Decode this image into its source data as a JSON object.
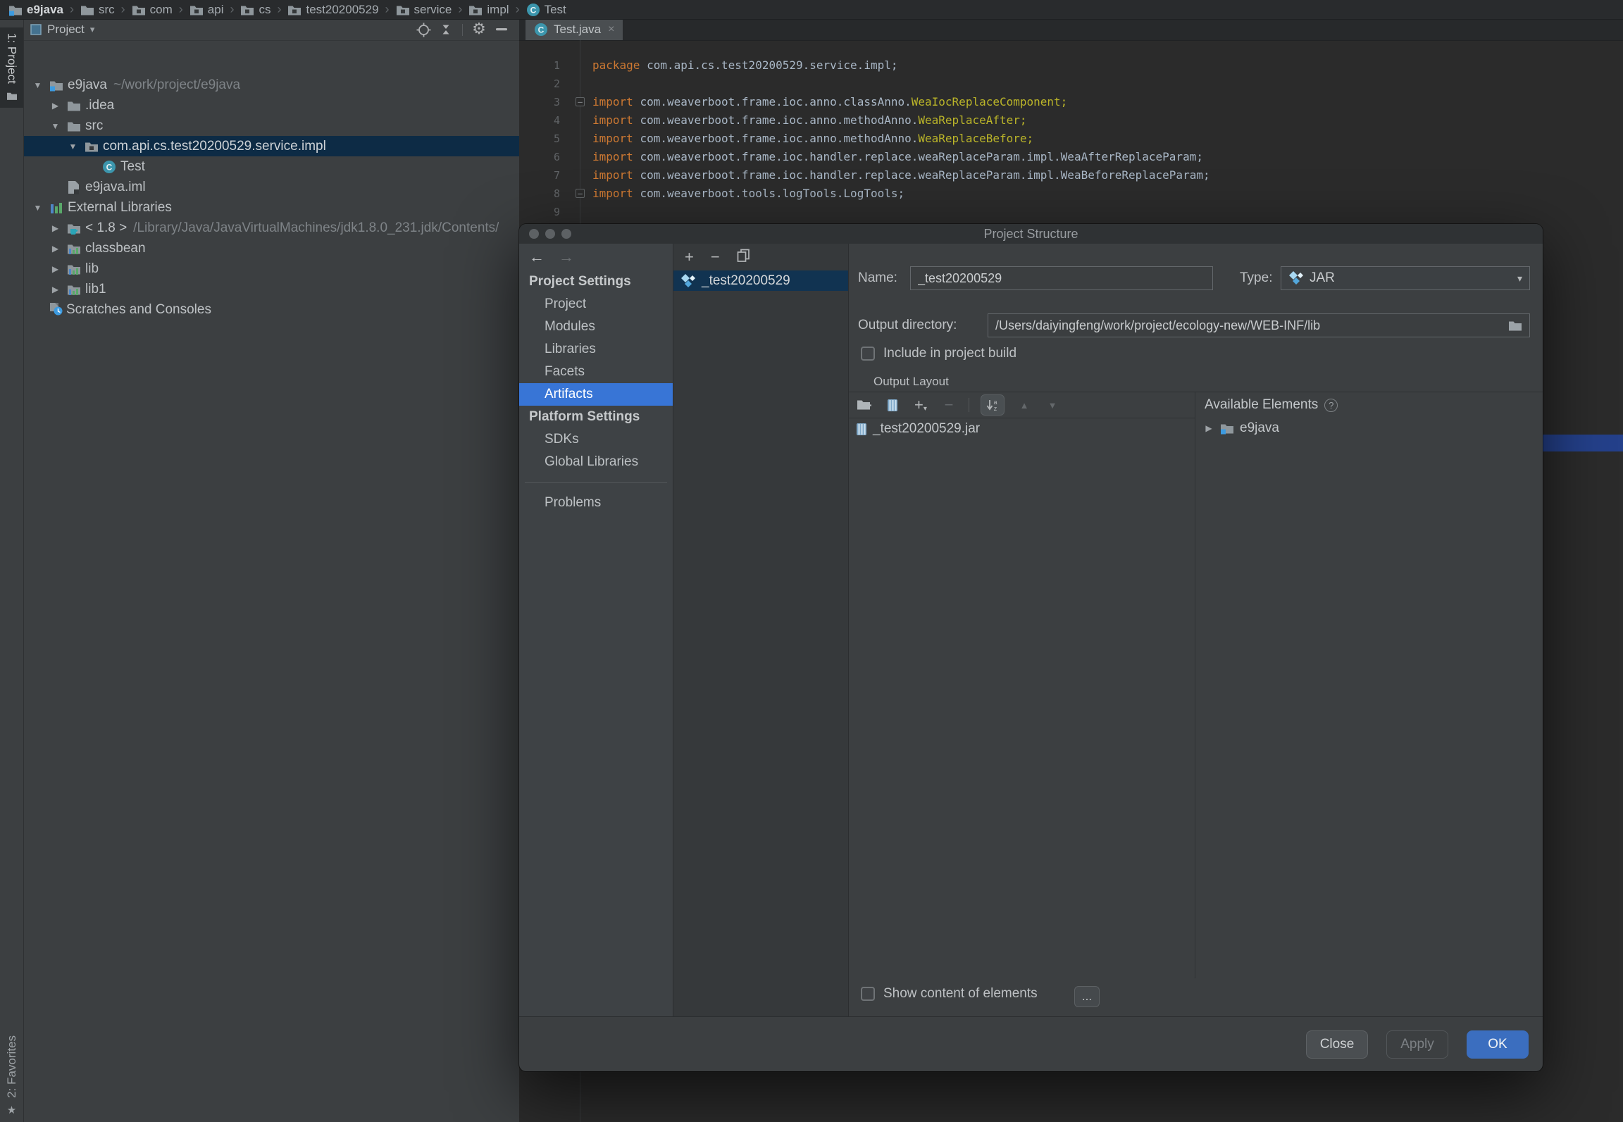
{
  "glyphs": {
    "expanded": "▼",
    "collapsed": "▶",
    "crumb_sep": "›",
    "dropdown": "▾",
    "fold": "–",
    "back": "←",
    "forward": "→",
    "plus": "+",
    "minus": "−",
    "up": "▲",
    "down": "▼",
    "close_tab": "×",
    "star": "★",
    "help": "?",
    "more": "...",
    "caret_small": "▾"
  },
  "colors": {
    "selection_focused": "#3875D6",
    "selection_unfocused": "#0D2B45",
    "list_selection": "#113351",
    "primary_button": "#3B6EBF",
    "keyword": "#CC7832",
    "code_text": "#A9B7C6",
    "annotation_class": "#BBB529",
    "editor_bg": "#2B2B2B",
    "panel_bg": "#3C3F41",
    "artifact_accent": "#7CC4EA",
    "blue_bar": "#24408A"
  },
  "breadcrumb": {
    "separator": "›",
    "items": [
      {
        "label": "e9java",
        "icon": "module"
      },
      {
        "label": "src",
        "icon": "folder"
      },
      {
        "label": "com",
        "icon": "package"
      },
      {
        "label": "api",
        "icon": "package"
      },
      {
        "label": "cs",
        "icon": "package"
      },
      {
        "label": "test20200529",
        "icon": "package"
      },
      {
        "label": "service",
        "icon": "package"
      },
      {
        "label": "impl",
        "icon": "package"
      },
      {
        "label": "Test",
        "icon": "class"
      }
    ]
  },
  "stripe": {
    "project": "1: Project",
    "favorites": "2: Favorites"
  },
  "project_panel": {
    "header": {
      "title": "Project",
      "actions": [
        "locate",
        "collapse-all",
        "settings",
        "hide"
      ]
    },
    "tree": [
      {
        "level": 0,
        "state": "expanded",
        "icon": "module",
        "label": "e9java",
        "hint": "~/work/project/e9java"
      },
      {
        "level": 1,
        "state": "collapsed",
        "icon": "folder",
        "label": ".idea"
      },
      {
        "level": 1,
        "state": "expanded",
        "icon": "folder",
        "label": "src"
      },
      {
        "level": 2,
        "state": "expanded",
        "icon": "package",
        "label": "com.api.cs.test20200529.service.impl",
        "selected": true
      },
      {
        "level": 3,
        "state": "none",
        "icon": "class",
        "label": "Test"
      },
      {
        "level": 1,
        "state": "none",
        "icon": "iml-file",
        "label": "e9java.iml"
      },
      {
        "level": 0,
        "state": "expanded",
        "icon": "external-libraries",
        "label": "External Libraries"
      },
      {
        "level": 1,
        "state": "collapsed",
        "icon": "jdk",
        "label": "< 1.8 >",
        "hint": "/Library/Java/JavaVirtualMachines/jdk1.8.0_231.jdk/Contents/"
      },
      {
        "level": 1,
        "state": "collapsed",
        "icon": "library",
        "label": "classbean"
      },
      {
        "level": 1,
        "state": "collapsed",
        "icon": "library",
        "label": "lib"
      },
      {
        "level": 1,
        "state": "collapsed",
        "icon": "library",
        "label": "lib1"
      },
      {
        "level": 1,
        "state": "none",
        "icon": "scratches",
        "label": "Scratches and Consoles",
        "icon_in_arrow_slot": true
      }
    ]
  },
  "editor": {
    "tab": {
      "label": "Test.java",
      "icon": "class"
    },
    "lines": [
      {
        "n": "1",
        "tokens": [
          {
            "s": "kw",
            "v": "package "
          },
          {
            "s": "p",
            "v": "com.api.cs.test20200529.service.impl;"
          }
        ]
      },
      {
        "n": "2",
        "tokens": []
      },
      {
        "n": "3",
        "fold": true,
        "tokens": [
          {
            "s": "kw",
            "v": "import "
          },
          {
            "s": "p",
            "v": "com.weaverboot.frame.ioc.anno.classAnno."
          },
          {
            "s": "y",
            "v": "WeaIocReplaceComponent;"
          }
        ]
      },
      {
        "n": "4",
        "tokens": [
          {
            "s": "kw",
            "v": "import "
          },
          {
            "s": "p",
            "v": "com.weaverboot.frame.ioc.anno.methodAnno."
          },
          {
            "s": "y",
            "v": "WeaReplaceAfter;"
          }
        ]
      },
      {
        "n": "5",
        "tokens": [
          {
            "s": "kw",
            "v": "import "
          },
          {
            "s": "p",
            "v": "com.weaverboot.frame.ioc.anno.methodAnno."
          },
          {
            "s": "y",
            "v": "WeaReplaceBefore;"
          }
        ]
      },
      {
        "n": "6",
        "tokens": [
          {
            "s": "kw",
            "v": "import "
          },
          {
            "s": "p",
            "v": "com.weaverboot.frame.ioc.handler.replace.weaReplaceParam.impl.WeaAfterReplaceParam;"
          }
        ]
      },
      {
        "n": "7",
        "tokens": [
          {
            "s": "kw",
            "v": "import "
          },
          {
            "s": "p",
            "v": "com.weaverboot.frame.ioc.handler.replace.weaReplaceParam.impl.WeaBeforeReplaceParam;"
          }
        ]
      },
      {
        "n": "8",
        "fold": true,
        "tokens": [
          {
            "s": "kw",
            "v": "import "
          },
          {
            "s": "p",
            "v": "com.weaverboot.tools.logTools.LogTools;"
          }
        ]
      },
      {
        "n": "9",
        "tokens": []
      }
    ]
  },
  "dialog": {
    "title": "Project Structure",
    "nav": {
      "sections": [
        {
          "header": "Project Settings",
          "items": [
            {
              "label": "Project"
            },
            {
              "label": "Modules"
            },
            {
              "label": "Libraries"
            },
            {
              "label": "Facets"
            },
            {
              "label": "Artifacts",
              "selected": true
            }
          ]
        },
        {
          "header": "Platform Settings",
          "items": [
            {
              "label": "SDKs"
            },
            {
              "label": "Global Libraries"
            }
          ]
        }
      ],
      "footer_item": "Problems"
    },
    "artifact_list": {
      "toolbar": [
        "add",
        "remove",
        "copy"
      ],
      "items": [
        {
          "label": "_test20200529",
          "selected": true
        }
      ]
    },
    "detail": {
      "name_label": "Name:",
      "name_value": "_test20200529",
      "type_label": "Type:",
      "type_value": "JAR",
      "output_dir_label": "Output directory:",
      "output_dir_value": "/Users/daiyingfeng/work/project/ecology-new/WEB-INF/lib",
      "include_label": "Include in project build",
      "output_layout_label": "Output Layout",
      "available_label": "Available Elements",
      "layout_toolbar": [
        "add-directory",
        "jar-content",
        "add",
        "remove",
        "separator",
        "sort-alpha",
        "move-up",
        "move-down"
      ],
      "left_tree": [
        {
          "label": "_test20200529.jar",
          "icon": "jar"
        }
      ],
      "right_tree": [
        {
          "label": "e9java",
          "icon": "module",
          "state": "collapsed"
        }
      ],
      "show_content_label": "Show content of elements",
      "more_label": "..."
    },
    "footer": {
      "close": "Close",
      "apply": "Apply",
      "ok": "OK"
    }
  }
}
